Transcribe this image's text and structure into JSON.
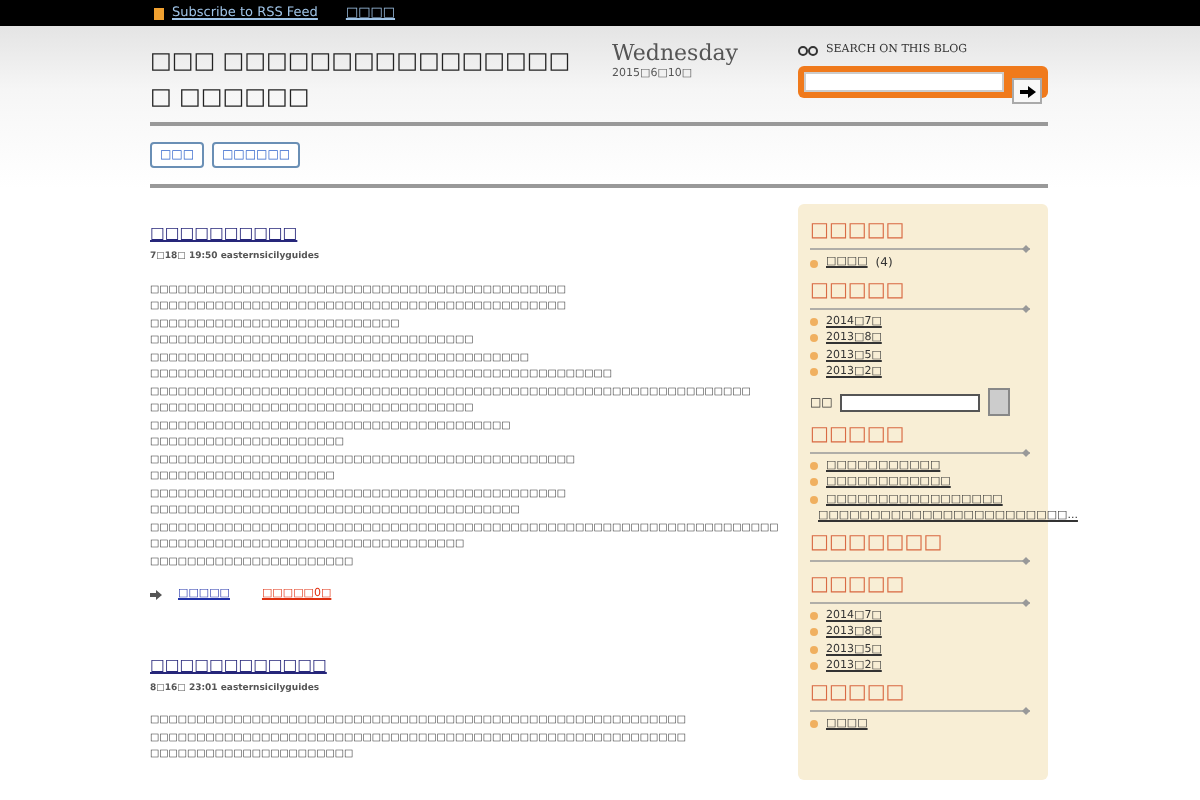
{
  "topbar": {
    "rss_link": "Subscribe to RSS Feed",
    "link": "□□□□"
  },
  "header": {
    "title": "□□□ □□□□□□□□□□□□□□□□□ □□□□□□",
    "day": "Wednesday",
    "date": "2015□6□10□",
    "search_label": "SEARCH ON THIS BLOG"
  },
  "nav": [
    "□□□",
    "□□□□□□"
  ],
  "posts": [
    {
      "title": "□□□□□□□□□□",
      "meta": "7□18□ 19:50 easternsicilyguides",
      "lines": [
        "□□□□□□□□□□□□□□□□□□□□□□□□□□□□□□□□□□□□□□□□□□□□□",
        "□□□□□□□□□□□□□□□□□□□□□□□□□□□□□□□□□□□□□□□□□□□□□",
        "□□□□□□□□□□□□□□□□□□□□□□□□□□□",
        "□□□□□□□□□□□□□□□□□□□□□□□□□□□□□□□□□□□",
        "□□□□□□□□□□□□□□□□□□□□□□□□□□□□□□□□□□□□□□□□□",
        "□□□□□□□□□□□□□□□□□□□□□□□□□□□□□□□□□□□□□□□□□□□□□□□□□□",
        "□□□□□□□□□□□□□□□□□□□□□□□□□□□□□□□□□□□□□□□□□□□□□□□□□□□□□□□□□□□□□□□□□",
        "□□□□□□□□□□□□□□□□□□□□□□□□□□□□□□□□□□□",
        "□□□□□□□□□□□□□□□□□□□□□□□□□□□□□□□□□□□□□□□",
        "□□□□□□□□□□□□□□□□□□□□□",
        "□□□□□□□□□□□□□□□□□□□□□□□□□□□□□□□□□□□□□□□□□□□□□□",
        "□□□□□□□□□□□□□□□□□□□□",
        "□□□□□□□□□□□□□□□□□□□□□□□□□□□□□□□□□□□□□□□□□□□□□",
        "□□□□□□□□□□□□□□□□□□□□□□□□□□□□□□□□□□□□□□□□",
        "□□□□□□□□□□□□□□□□□□□□□□□□□□□□□□□□□□□□□□□□□□□□□□□□□□□□□□□□□□□□□□□□□□□□",
        "□□□□□□□□□□□□□□□□□□□□□□□□□□□□□□□□□□",
        "□□□□□□□□□□□□□□□□□□□□□□"
      ],
      "footer": {
        "link": "□□□□□",
        "comments": "□□□□□0□"
      }
    },
    {
      "title": "□□□□□□□□□□□□",
      "meta": "8□16□ 23:01 easternsicilyguides",
      "lines": [
        "□□□□□□□□□□□□□□□□□□□□□□□□□□□□□□□□□□□□□□□□□□□□□□□□□□□□□□□□□□",
        "□□□□□□□□□□□□□□□□□□□□□□□□□□□□□□□□□□□□□□□□□□□□□□□□□□□□□□□□□□",
        "□□□□□□□□□□□□□□□□□□□□□□"
      ]
    }
  ],
  "sidebar": [
    {
      "heading": "□□□□□",
      "items": [
        {
          "text": "□□□□",
          "count": "(4)"
        }
      ]
    },
    {
      "heading": "□□□□□",
      "items": [
        {
          "text": "2014□7□"
        },
        {
          "text": "2013□8□"
        },
        {
          "text": "2013□5□"
        },
        {
          "text": "2013□2□"
        }
      ],
      "search": {
        "label": "□□"
      }
    },
    {
      "heading": "□□□□□",
      "items": [
        {
          "text": "□□□□□□□□□□□"
        },
        {
          "text": "□□□□□□□□□□□□"
        },
        {
          "text": "□□□□□□□□□□□□□□□□□"
        },
        {
          "text": "□□□□□□□□□□□□□□□□□□□□□□□□..."
        }
      ]
    },
    {
      "heading": "□□□□□□□"
    },
    {
      "heading": "□□□□□",
      "items": [
        {
          "text": "2014□7□"
        },
        {
          "text": "2013□8□"
        },
        {
          "text": "2013□5□"
        },
        {
          "text": "2013□2□"
        }
      ]
    },
    {
      "heading": "□□□□□",
      "items": [
        {
          "text": "□□□□"
        }
      ]
    }
  ]
}
